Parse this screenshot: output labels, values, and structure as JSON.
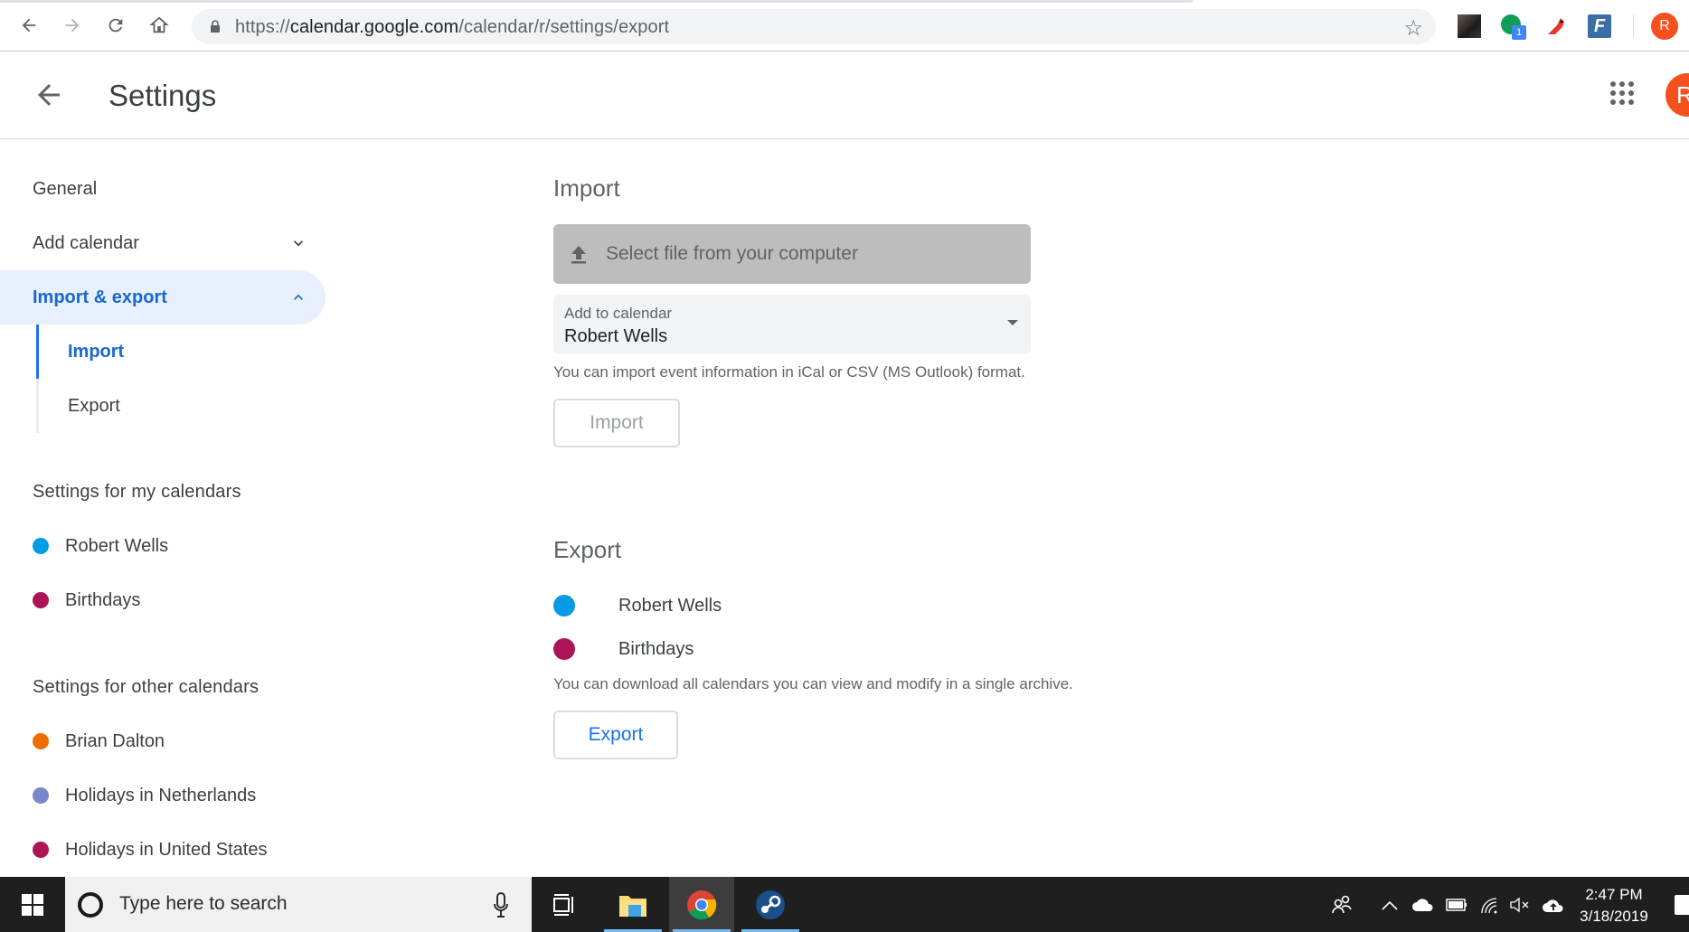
{
  "browser": {
    "url_scheme": "https://",
    "url_host": "calendar.google.com",
    "url_path": "/calendar/r/settings/export",
    "profile_initial": "R",
    "extension_badge": "1"
  },
  "header": {
    "title": "Settings",
    "avatar_initial": "R"
  },
  "sidebar": {
    "items": [
      {
        "label": "General"
      },
      {
        "label": "Add calendar"
      },
      {
        "label": "Import & export"
      }
    ],
    "sub_items": [
      {
        "label": "Import"
      },
      {
        "label": "Export"
      }
    ],
    "my_calendars_heading": "Settings for my calendars",
    "my_calendars": [
      {
        "label": "Robert Wells",
        "color": "#039be5"
      },
      {
        "label": "Birthdays",
        "color": "#ad1457"
      }
    ],
    "other_calendars_heading": "Settings for other calendars",
    "other_calendars": [
      {
        "label": "Brian Dalton",
        "color": "#ef6c00"
      },
      {
        "label": "Holidays in Netherlands",
        "color": "#7986cb"
      },
      {
        "label": "Holidays in United States",
        "color": "#ad1457"
      }
    ]
  },
  "import": {
    "title": "Import",
    "file_button_label": "Select file from your computer",
    "select_label": "Add to calendar",
    "select_value": "Robert Wells",
    "help_text": "You can import event information in iCal or CSV (MS Outlook) format.",
    "button_label": "Import"
  },
  "export": {
    "title": "Export",
    "calendars": [
      {
        "label": "Robert Wells",
        "color": "#039be5"
      },
      {
        "label": "Birthdays",
        "color": "#ad1457"
      }
    ],
    "help_text": "You can download all calendars you can view and modify in a single archive.",
    "button_label": "Export"
  },
  "taskbar": {
    "search_placeholder": "Type here to search",
    "time": "2:47 PM",
    "date": "3/18/2019"
  },
  "colors": {
    "accent": "#1a73e8",
    "active_bg": "#e8f0fe"
  }
}
